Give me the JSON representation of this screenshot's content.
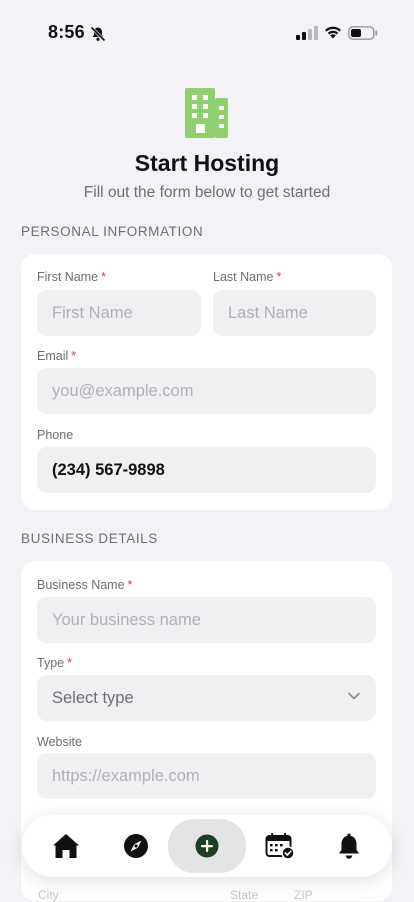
{
  "status_bar": {
    "time": "8:56"
  },
  "header": {
    "title": "Start Hosting",
    "subtitle": "Fill out the form below to get started",
    "icon": "building-icon",
    "accent_color": "#8fcf6e"
  },
  "personal": {
    "section_title": "PERSONAL INFORMATION",
    "first_name": {
      "label": "First Name",
      "required": "*",
      "placeholder": "First Name"
    },
    "last_name": {
      "label": "Last Name",
      "required": "*",
      "placeholder": "Last Name"
    },
    "email": {
      "label": "Email",
      "required": "*",
      "placeholder": "you@example.com"
    },
    "phone": {
      "label": "Phone",
      "value": "(234) 567-9898"
    }
  },
  "business": {
    "section_title": "BUSINESS DETAILS",
    "name": {
      "label": "Business Name",
      "required": "*",
      "placeholder": "Your business name"
    },
    "type": {
      "label": "Type",
      "required": "*",
      "value": "Select type"
    },
    "website": {
      "label": "Website",
      "placeholder": "https://example.com"
    },
    "city": {
      "label": "City"
    },
    "state": {
      "label": "State"
    },
    "zip": {
      "label": "ZIP"
    }
  },
  "tabbar": {
    "items": [
      "home-icon",
      "compass-icon",
      "add-icon",
      "calendar-check-icon",
      "bell-icon"
    ],
    "active": "add-icon",
    "active_color": "#1f3d24"
  }
}
